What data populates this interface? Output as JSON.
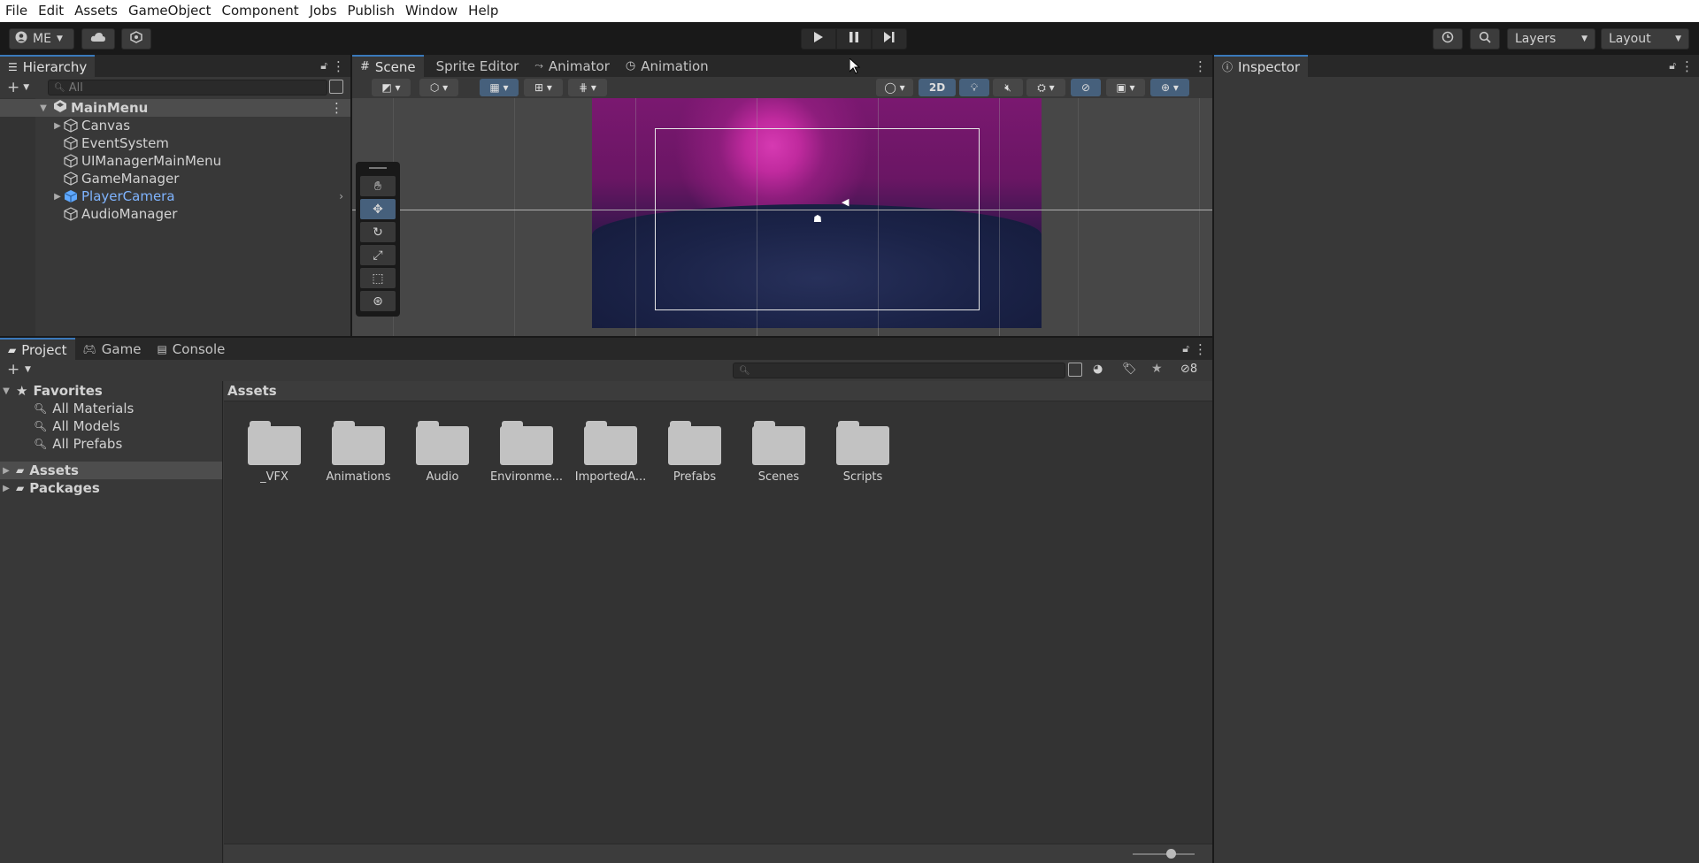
{
  "menu": [
    "File",
    "Edit",
    "Assets",
    "GameObject",
    "Component",
    "Jobs",
    "Publish",
    "Window",
    "Help"
  ],
  "toolbar": {
    "account_label": "ME",
    "layers_label": "Layers",
    "layout_label": "Layout"
  },
  "hierarchy": {
    "tab_label": "Hierarchy",
    "search_placeholder": "All",
    "scene_name": "MainMenu",
    "items": [
      {
        "label": "Canvas",
        "has_children": true,
        "selected": false
      },
      {
        "label": "EventSystem",
        "has_children": false,
        "selected": false
      },
      {
        "label": "UIManagerMainMenu",
        "has_children": false,
        "selected": false
      },
      {
        "label": "GameManager",
        "has_children": false,
        "selected": false
      },
      {
        "label": "PlayerCamera",
        "has_children": true,
        "selected": false,
        "highlight": true
      },
      {
        "label": "AudioManager",
        "has_children": false,
        "selected": false
      }
    ]
  },
  "scene_tabs": {
    "scene": "Scene",
    "sprite_editor": "Sprite Editor",
    "animator": "Animator",
    "animation": "Animation",
    "mode_2d": "2D"
  },
  "inspector": {
    "tab_label": "Inspector"
  },
  "bottom_tabs": {
    "project": "Project",
    "game": "Game",
    "console": "Console"
  },
  "project": {
    "hidden_count": "8",
    "favorites_label": "Favorites",
    "favorites": [
      "All Materials",
      "All Models",
      "All Prefabs"
    ],
    "roots": [
      "Assets",
      "Packages"
    ],
    "breadcrumb": "Assets",
    "folders": [
      "_VFX",
      "Animations",
      "Audio",
      "Environme...",
      "ImportedA...",
      "Prefabs",
      "Scenes",
      "Scripts"
    ]
  },
  "colors": {
    "accent": "#3a79bb",
    "selected_tool": "#46607c",
    "highlight_text": "#7fb4ff"
  }
}
